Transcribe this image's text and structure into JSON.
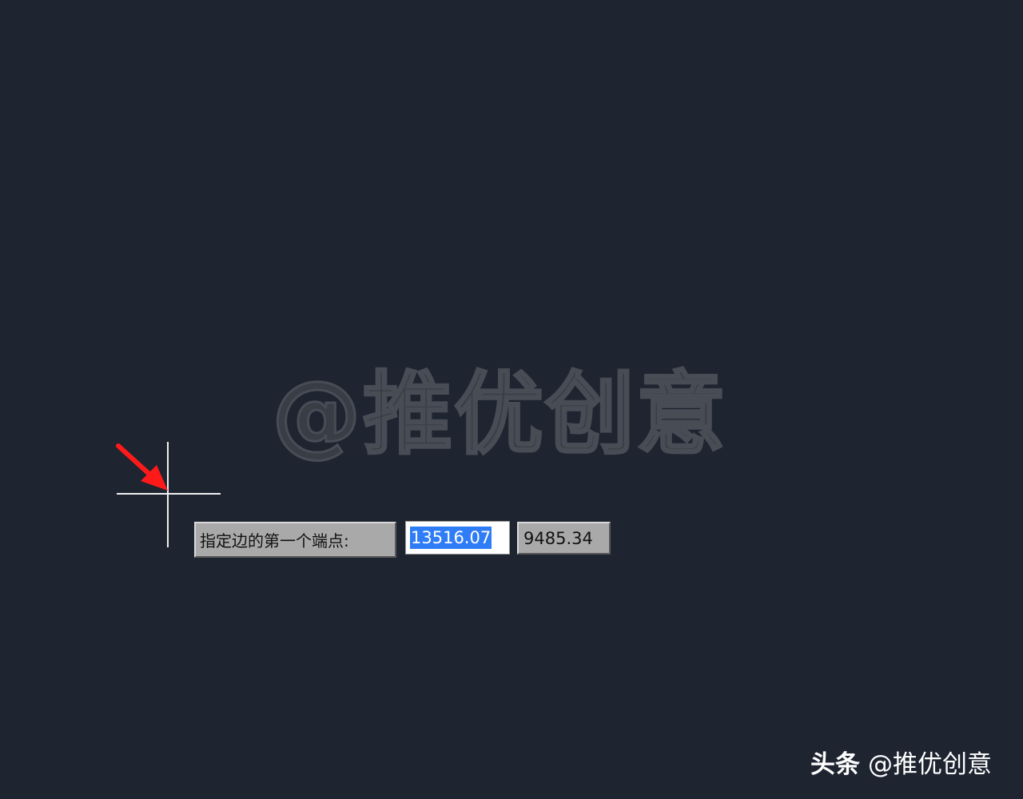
{
  "watermark": {
    "text": "@推优创意"
  },
  "command_prompt": {
    "label": "指定边的第一个端点:",
    "x_value": "13516.07",
    "y_value": "9485.34"
  },
  "footer": {
    "brand": "头条",
    "handle": "@推优创意"
  },
  "colors": {
    "background": "#1e2430",
    "crosshair": "#f0f0f0",
    "selection": "#2f7df6",
    "arrow": "#ff1a1a"
  },
  "icons": {
    "cursor": "crosshair-cursor-icon",
    "pointer": "red-arrow-icon"
  }
}
